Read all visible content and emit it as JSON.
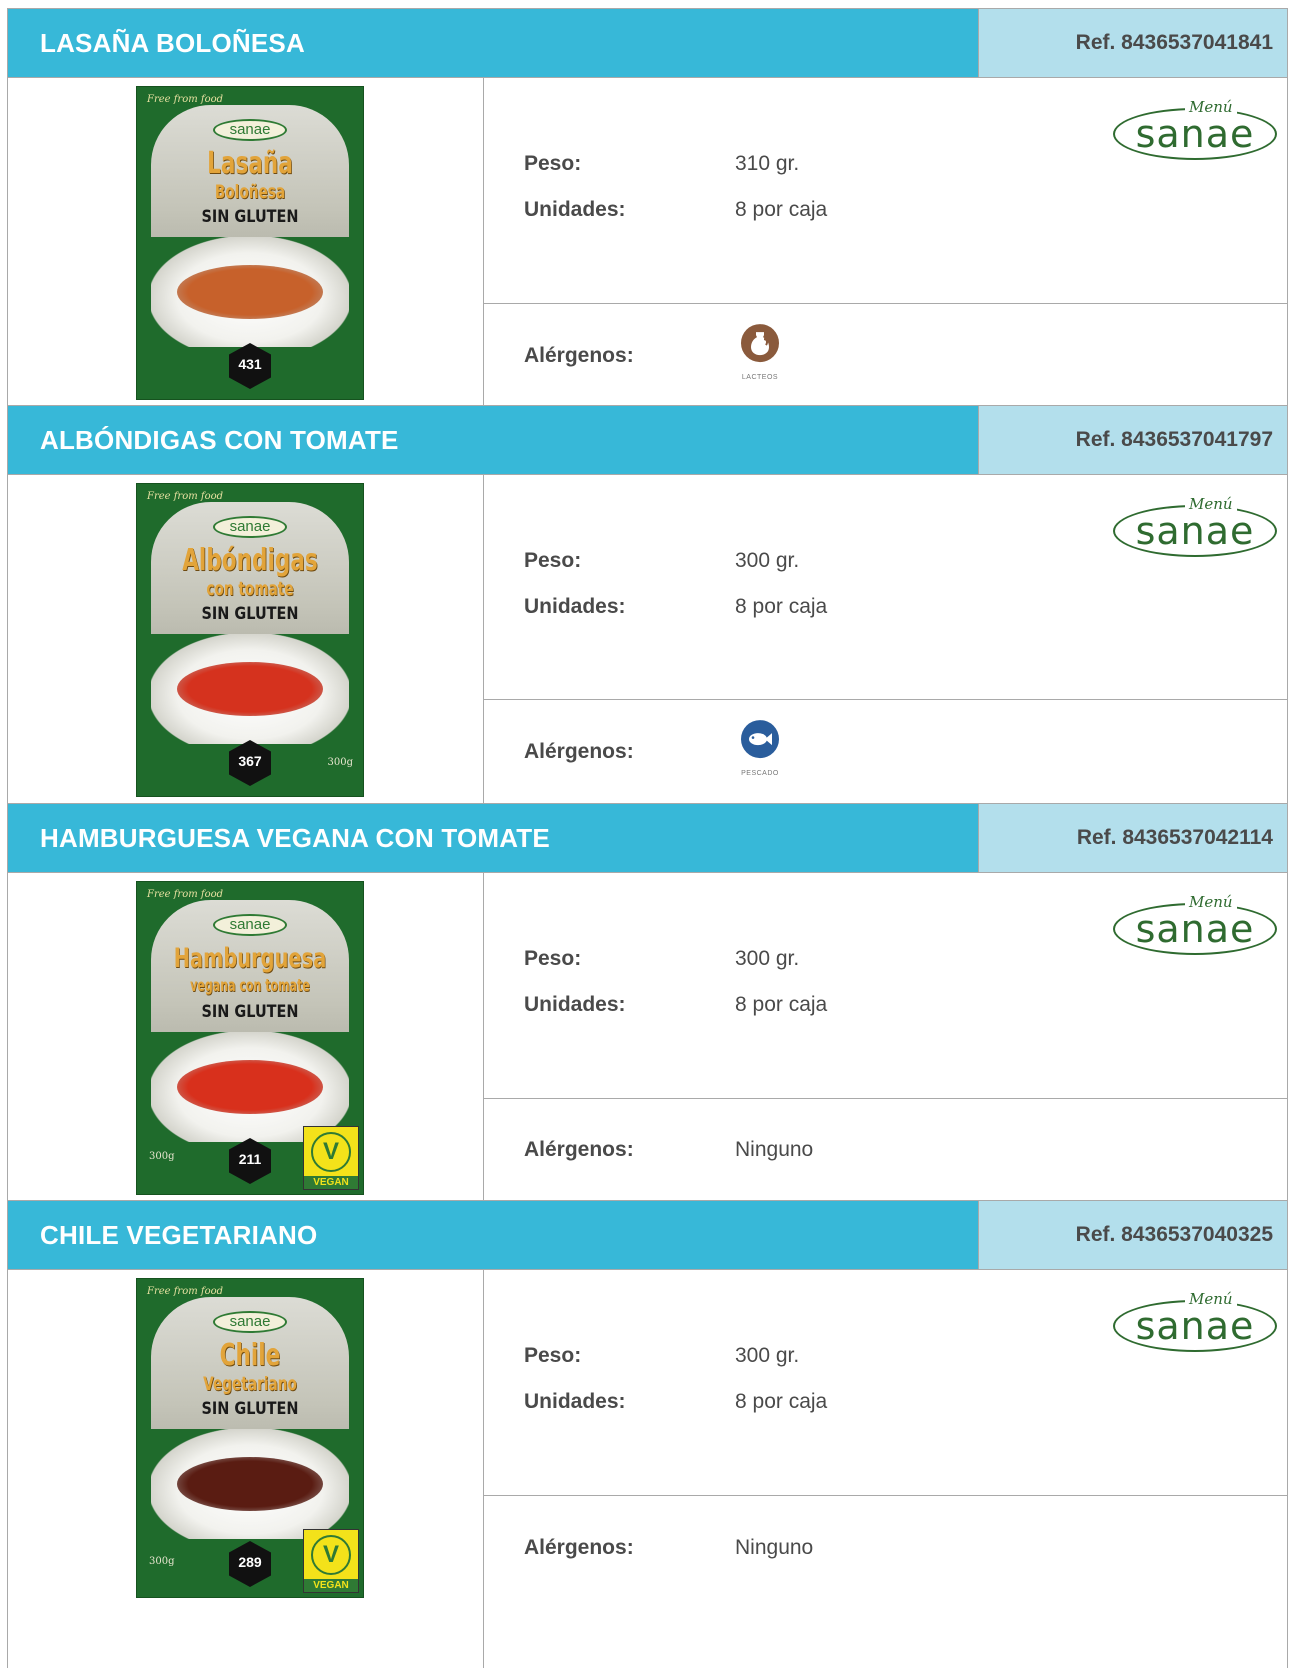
{
  "labels": {
    "peso": "Peso:",
    "unidades": "Unidades:",
    "alergenos": "Alérgenos:"
  },
  "brand": {
    "menu": "Menú",
    "name": "sanae"
  },
  "products": [
    {
      "name": "LASAÑA BOLOÑESA",
      "ref": "Ref. 8436537041841",
      "peso": "310 gr.",
      "unidades": "8 por caja",
      "alergenos_text": "",
      "allergen_icon": "lacteos-icon",
      "allergen_caption": "LACTEOS",
      "allergen_color": "#8a5a3c",
      "package": {
        "tag": "Free from food",
        "brand": "sanae",
        "name": "Lasaña",
        "sub": "Boloñesa",
        "gluten": "SIN GLUTEN",
        "kcal": "431",
        "weight": "",
        "vegan": false,
        "food_color": "#c7612b"
      }
    },
    {
      "name": "ALBÓNDIGAS CON TOMATE",
      "ref": "Ref. 8436537041797",
      "peso": "300 gr.",
      "unidades": "8 por caja",
      "alergenos_text": "",
      "allergen_icon": "pescado-icon",
      "allergen_caption": "PESCADO",
      "allergen_color": "#2a5d9c",
      "package": {
        "tag": "Free from food",
        "brand": "sanae",
        "name": "Albóndigas",
        "sub": "con tomate",
        "gluten": "SIN GLUTEN",
        "kcal": "367",
        "weight": "300g",
        "vegan": false,
        "food_color": "#d5321e"
      }
    },
    {
      "name": "HAMBURGUESA VEGANA CON TOMATE",
      "ref": "Ref. 8436537042114",
      "peso": "300 gr.",
      "unidades": "8 por caja",
      "alergenos_text": "Ninguno",
      "allergen_icon": "",
      "allergen_caption": "",
      "allergen_color": "",
      "package": {
        "tag": "Free from food",
        "brand": "sanae",
        "name": "Hamburguesa",
        "sub": "vegana con tomate",
        "gluten": "SIN GLUTEN",
        "kcal": "211",
        "weight": "300g",
        "vegan": true,
        "food_color": "#d8301c"
      }
    },
    {
      "name": "CHILE VEGETARIANO",
      "ref": "Ref. 8436537040325",
      "peso": "300 gr.",
      "unidades": "8 por caja",
      "alergenos_text": "Ninguno",
      "allergen_icon": "",
      "allergen_caption": "",
      "allergen_color": "",
      "package": {
        "tag": "Free from food",
        "brand": "sanae",
        "name": "Chile",
        "sub": "Vegetariano",
        "gluten": "SIN GLUTEN",
        "kcal": "289",
        "weight": "300g",
        "vegan": true,
        "food_color": "#5a1c12"
      }
    }
  ]
}
